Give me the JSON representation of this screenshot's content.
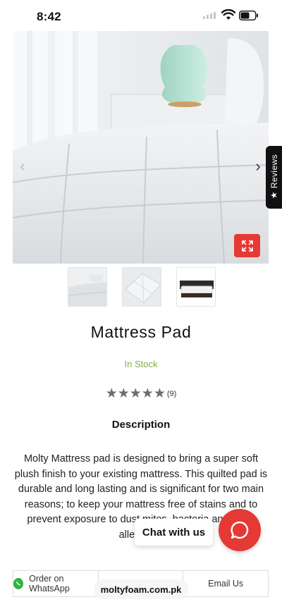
{
  "status_bar": {
    "time": "8:42"
  },
  "product": {
    "title": "Mattress Pad",
    "stock": "In Stock",
    "rating_count": "(9)",
    "stars": 5
  },
  "reviews_tab": {
    "label": "Reviews"
  },
  "description": {
    "heading": "Description",
    "text": "Molty Mattress pad is designed to bring a super soft plush finish to your existing mattress. This quilted pad is durable and long lasting and is significant for two main reasons; to keep your mattress free of stains and to prevent exposure to dust mites, bacteria and other allergens."
  },
  "chat": {
    "label": "Chat with us"
  },
  "bottom_bar": {
    "whatsapp_label": "Order on WhatsApp",
    "email_label": "Email Us"
  },
  "browser": {
    "url": "moltyfoam.com.pk"
  },
  "colors": {
    "accent": "#e53935",
    "stock": "#7cb342",
    "whatsapp": "#2fb342"
  },
  "icons": [
    "signal-icon",
    "wifi-icon",
    "battery-icon",
    "chevron-left-icon",
    "chevron-right-icon",
    "expand-icon",
    "star-icon",
    "chat-icon",
    "whatsapp-icon"
  ]
}
